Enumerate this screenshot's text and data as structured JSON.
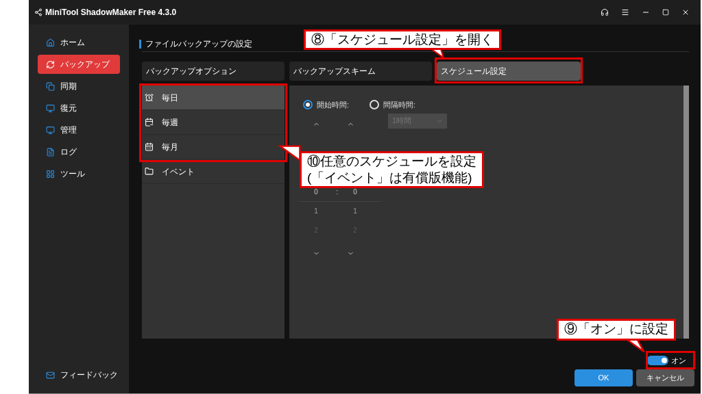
{
  "window": {
    "title": "MiniTool ShadowMaker Free 4.3.0"
  },
  "sidebar": {
    "items": [
      {
        "label": "ホーム",
        "selected": false
      },
      {
        "label": "バックアップ",
        "selected": true
      },
      {
        "label": "同期",
        "selected": false
      },
      {
        "label": "復元",
        "selected": false
      },
      {
        "label": "管理",
        "selected": false
      },
      {
        "label": "ログ",
        "selected": false
      },
      {
        "label": "ツール",
        "selected": false
      }
    ],
    "feedback": "フィードバック"
  },
  "page_title": "ファイルバックアップの設定",
  "tabs": [
    {
      "label": "バックアップオプション",
      "selected": false
    },
    {
      "label": "バックアップスキーム",
      "selected": false
    },
    {
      "label": "スケジュール設定",
      "selected": true
    }
  ],
  "schedule_types": [
    {
      "label": "毎日",
      "selected": true
    },
    {
      "label": "毎週",
      "selected": false
    },
    {
      "label": "毎月",
      "selected": false
    },
    {
      "label": "イベント",
      "selected": false
    }
  ],
  "schedule": {
    "options": [
      {
        "label": "開始時間:",
        "selected": true
      },
      {
        "label": "間隔時間:",
        "selected": false
      }
    ],
    "interval_select": {
      "value": "1時間",
      "disabled": true
    },
    "time_picker": {
      "separator": ":",
      "hours": [
        "0",
        "1",
        "2"
      ],
      "minutes": [
        "0",
        "1",
        "2"
      ]
    }
  },
  "toggle": {
    "on": true,
    "label": "オン"
  },
  "buttons": [
    {
      "label": "OK",
      "kind": "primary"
    },
    {
      "label": "キャンセル",
      "kind": "secondary"
    }
  ],
  "annotations": [
    {
      "lines": [
        "⑧「スケジュール設定」を開く"
      ]
    },
    {
      "lines": [
        "⑩任意のスケジュールを設定",
        "(「イベント」は有償版機能)"
      ]
    },
    {
      "lines": [
        "⑨「オン」に設定"
      ]
    }
  ]
}
